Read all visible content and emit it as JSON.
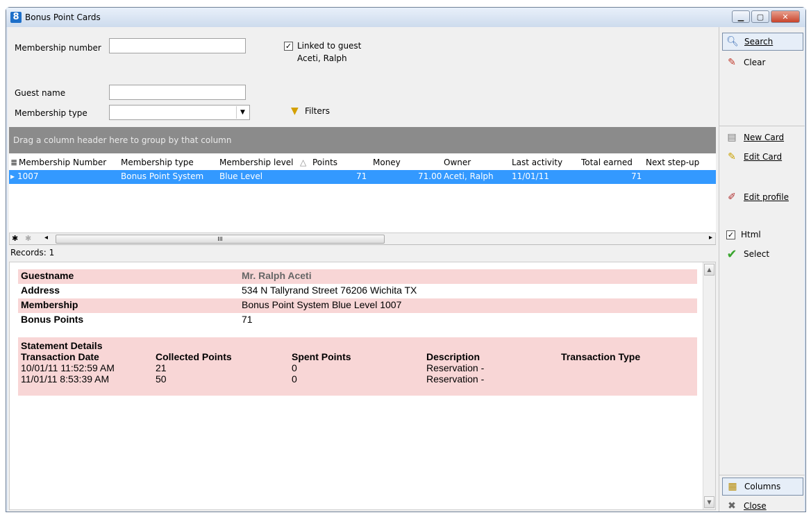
{
  "window": {
    "title": "Bonus Point Cards",
    "app_icon": "8"
  },
  "search": {
    "membership_number_label": "Membership number",
    "membership_number_value": "",
    "linked_label": "Linked to guest",
    "linked_guest": "Aceti, Ralph",
    "linked_checked": true,
    "guest_name_label": "Guest name",
    "guest_name_value": "",
    "membership_type_label": "Membership type",
    "membership_type_value": "",
    "filters_label": "Filters"
  },
  "grid": {
    "group_hint": "Drag a column header here to group by that column",
    "columns": [
      "Membership Number",
      "Membership type",
      "Membership level",
      "Points",
      "Money",
      "Owner",
      "Last activity",
      "Total earned",
      "Next step-up"
    ],
    "row": {
      "number": "1007",
      "type": "Bonus Point System",
      "level": "Blue Level",
      "points": "71",
      "money": "71.00",
      "owner": "Aceti, Ralph",
      "last_activity": "11/01/11",
      "total_earned": "71",
      "next_step": ""
    },
    "records": "Records: 1"
  },
  "detail": {
    "rows": [
      {
        "key": "Guestname",
        "value": "Mr. Ralph Aceti"
      },
      {
        "key": "Address",
        "value": "534 N Tallyrand Street 76206 Wichita TX"
      },
      {
        "key": "Membership",
        "value": "Bonus Point System Blue Level 1007"
      },
      {
        "key": "Bonus Points",
        "value": "71"
      }
    ],
    "statement_title": "Statement Details",
    "statement_headers": [
      "Transaction Date",
      "Collected Points",
      "Spent Points",
      "Description",
      "Transaction Type"
    ],
    "statement_rows": [
      [
        "10/01/11 11:52:59 AM",
        "21",
        "0",
        "Reservation -",
        ""
      ],
      [
        "11/01/11 8:53:39 AM",
        "50",
        "0",
        "Reservation -",
        ""
      ]
    ]
  },
  "sidebar": {
    "search": "Search",
    "clear": "Clear",
    "new_card": "New Card",
    "edit_card": "Edit Card",
    "edit_profile": "Edit profile",
    "html": "Html",
    "html_checked": true,
    "select": "Select",
    "columns": "Columns",
    "close": "Close"
  }
}
